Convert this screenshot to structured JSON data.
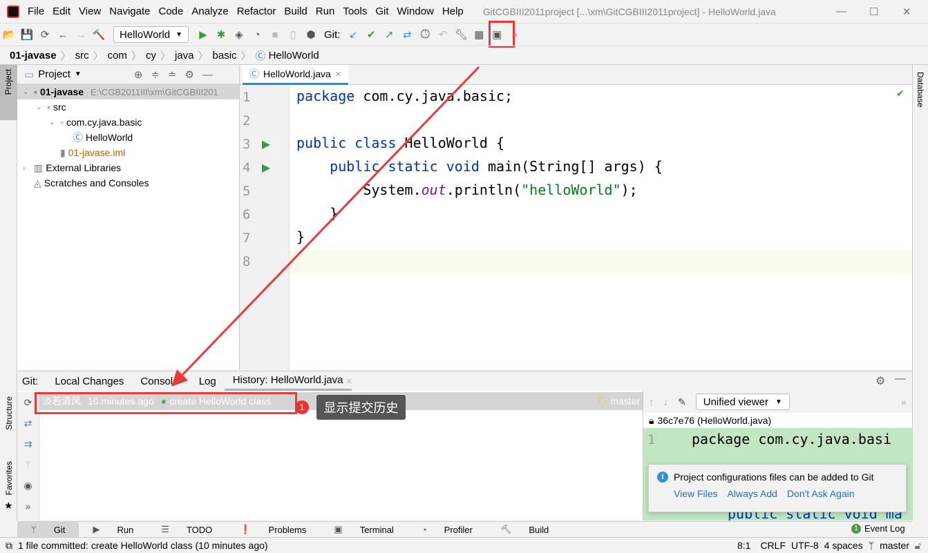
{
  "menu": [
    "File",
    "Edit",
    "View",
    "Navigate",
    "Code",
    "Analyze",
    "Refactor",
    "Build",
    "Run",
    "Tools",
    "Git",
    "Window",
    "Help"
  ],
  "window_title": "GitCGBIII2011project [...\\xm\\GitCGBIII2011project] - HelloWorld.java",
  "toolbar": {
    "run_config": "HelloWorld",
    "git_label": "Git:"
  },
  "breadcrumb": [
    "01-javase",
    "src",
    "com",
    "cy",
    "java",
    "basic",
    "HelloWorld"
  ],
  "project": {
    "title": "Project",
    "tree": [
      {
        "label": "01-javase",
        "extra": "E:\\CGB2011III\\xm\\GitCGBIII201",
        "indent": 0,
        "icon": "module-folder-icon"
      },
      {
        "label": "src",
        "indent": 1,
        "icon": "source-folder-icon"
      },
      {
        "label": "com.cy.java.basic",
        "indent": 2,
        "icon": "package-icon"
      },
      {
        "label": "HelloWorld",
        "indent": 3,
        "icon": "java-class-icon"
      },
      {
        "label": "01-javase.iml",
        "indent": 2,
        "icon": "iml-file-icon"
      },
      {
        "label": "External Libraries",
        "indent": 0,
        "icon": "library-icon"
      },
      {
        "label": "Scratches and Consoles",
        "indent": 0,
        "icon": "scratches-icon"
      }
    ]
  },
  "editor": {
    "tab": "HelloWorld.java",
    "lines": [
      "1",
      "2",
      "3",
      "4",
      "5",
      "6",
      "7",
      "8"
    ]
  },
  "side": {
    "left_top": "Project",
    "structure": "Structure",
    "favorites": "Favorites",
    "database": "Database"
  },
  "git_panel": {
    "label": "Git:",
    "tabs": [
      "Local Changes",
      "Console",
      "Log",
      "History: HelloWorld.java"
    ],
    "history_row": {
      "author": "淡若清风",
      "time": "10 minutes ago",
      "message": "create HelloWorld class",
      "branch": "master"
    }
  },
  "annotation": {
    "badge": "1",
    "tooltip": "显示提交历史"
  },
  "diff": {
    "viewer": "Unified viewer",
    "file": "36c7e76 (HelloWorld.java)",
    "line": "1",
    "code": "package com.cy.java.basi",
    "code2": "public static void ma"
  },
  "notification": {
    "text": "Project configurations files can be added to Git",
    "actions": [
      "View Files",
      "Always Add",
      "Don't Ask Again"
    ]
  },
  "bottom_tools": [
    "Git",
    "Run",
    "TODO",
    "Problems",
    "Terminal",
    "Profiler",
    "Build"
  ],
  "event_log": {
    "count": "1",
    "label": "Event Log"
  },
  "status": {
    "message": "1 file committed: create HelloWorld class (10 minutes ago)",
    "position": "8:1",
    "line_sep": "CRLF",
    "encoding": "UTF-8",
    "indent": "4 spaces",
    "branch": "master"
  },
  "colors": {
    "accent": "#4083c9",
    "annotation_red": "#e83a3a",
    "keyword": "#0033b3",
    "string": "#067d17",
    "diff_added": "#c1e6c1"
  }
}
